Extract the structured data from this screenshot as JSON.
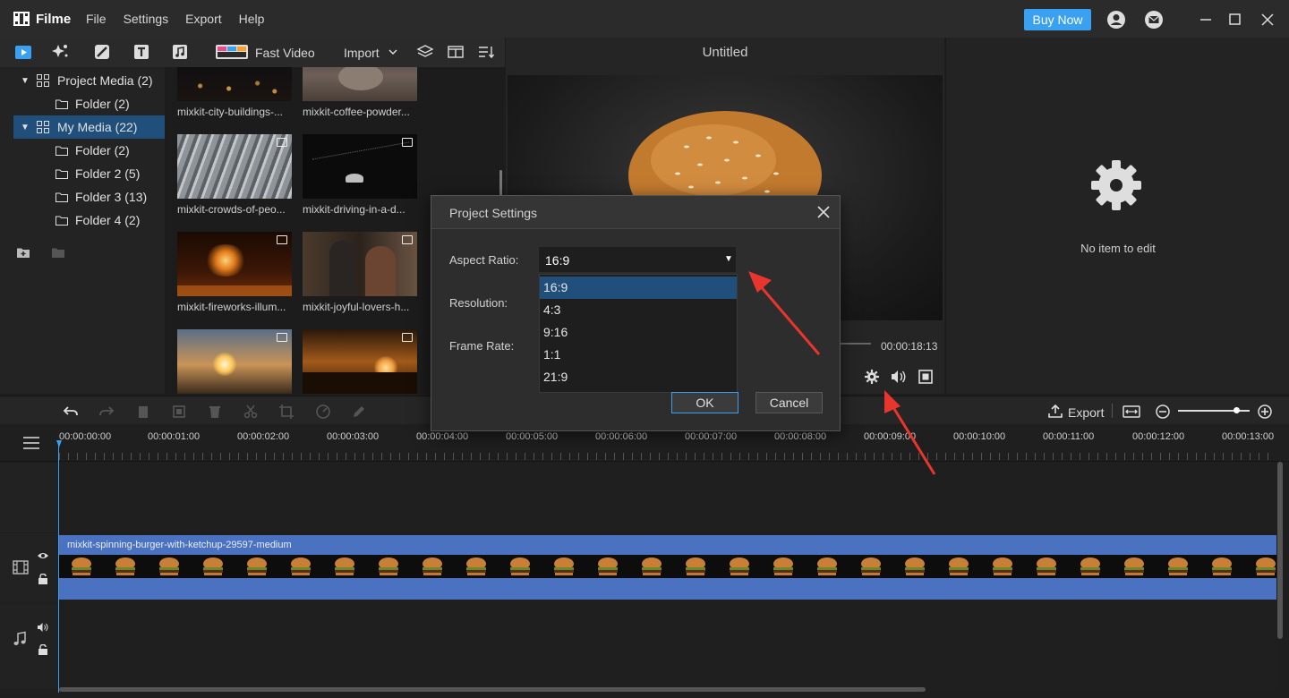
{
  "app": {
    "name": "Filme"
  },
  "menu": [
    "File",
    "Settings",
    "Export",
    "Help"
  ],
  "title_bar": {
    "buy_now": "Buy Now"
  },
  "media_toolbar": {
    "fast_video": "Fast Video",
    "import": "Import"
  },
  "sidebar": {
    "items": [
      {
        "label": "Project Media (2)",
        "expanded": true
      },
      {
        "label": "Folder (2)"
      },
      {
        "label": "My Media (22)",
        "expanded": true,
        "selected": true
      },
      {
        "label": "Folder (2)"
      },
      {
        "label": "Folder 2 (5)"
      },
      {
        "label": "Folder 3 (13)"
      },
      {
        "label": "Folder 4 (2)"
      }
    ]
  },
  "media": [
    {
      "label": "mixkit-city-buildings-..."
    },
    {
      "label": "mixkit-coffee-powder..."
    },
    {
      "label": "mixkit-crowds-of-peo..."
    },
    {
      "label": "mixkit-driving-in-a-d..."
    },
    {
      "label": "mixkit-fireworks-illum..."
    },
    {
      "label": "mixkit-joyful-lovers-h..."
    }
  ],
  "preview": {
    "title": "Untitled",
    "duration": "00:00:18:13"
  },
  "properties": {
    "empty_text": "No item to edit"
  },
  "timeline": {
    "export_label": "Export",
    "ticks": [
      "00:00:00:00",
      "00:00:01:00",
      "00:00:02:00",
      "00:00:03:00",
      "00:00:04:00",
      "00:00:05:00",
      "00:00:06:00",
      "00:00:07:00",
      "00:00:08:00",
      "00:00:09:00",
      "00:00:10:00",
      "00:00:11:00",
      "00:00:12:00",
      "00:00:13:00"
    ],
    "clip_name": "mixkit-spinning-burger-with-ketchup-29597-medium"
  },
  "dialog": {
    "title": "Project Settings",
    "aspect_label": "Aspect Ratio:",
    "resolution_label": "Resolution:",
    "framerate_label": "Frame Rate:",
    "aspect_value": "16:9",
    "options": [
      "16:9",
      "4:3",
      "9:16",
      "1:1",
      "21:9"
    ],
    "ok": "OK",
    "cancel": "Cancel"
  },
  "colors": {
    "accent": "#3aa1f2",
    "selection": "#1f4f7a",
    "clip": "#4a72c0",
    "arrow": "#e8352e"
  }
}
